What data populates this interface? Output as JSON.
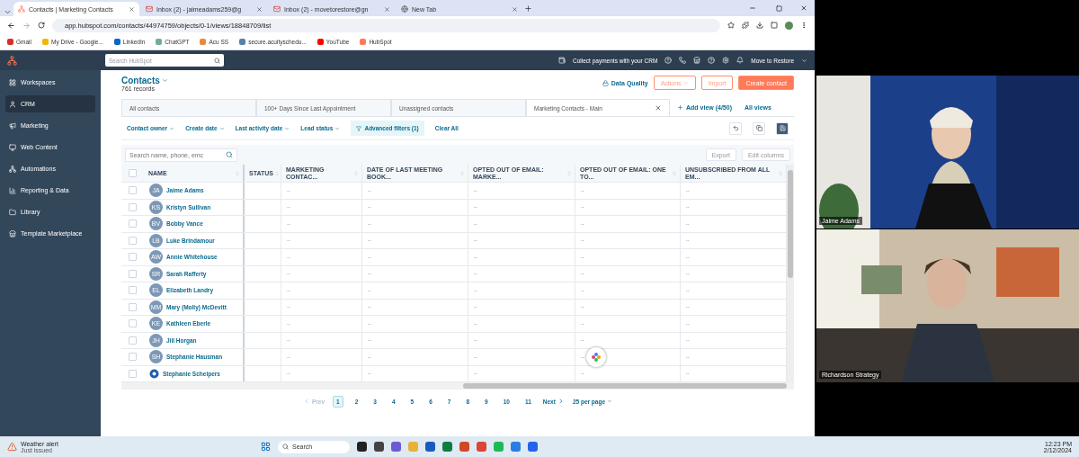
{
  "browser": {
    "tabs": [
      {
        "title": "Contacts | Marketing Contacts",
        "kind": "hubspot",
        "selected": true
      },
      {
        "title": "Inbox (2) - jaimeadams259@g",
        "kind": "mail",
        "selected": false
      },
      {
        "title": "Inbox (2) - movetorestore@gn",
        "kind": "mail",
        "selected": false
      },
      {
        "title": "New Tab",
        "kind": "globe",
        "selected": false
      }
    ],
    "url": "app.hubspot.com/contacts/44974759/objects/0-1/views/18848709/list",
    "bookmarks": [
      {
        "label": "Gmail",
        "color": "#d93025"
      },
      {
        "label": "My Drive - Google...",
        "color": "#f4b400"
      },
      {
        "label": "LinkedIn",
        "color": "#0a66c2"
      },
      {
        "label": "ChatGPT",
        "color": "#74aa9c"
      },
      {
        "label": "Acu SS",
        "color": "#e8893a"
      },
      {
        "label": "secure.acuityschedu...",
        "color": "#5b7fa8"
      },
      {
        "label": "YouTube",
        "color": "#ff0000"
      },
      {
        "label": "HubSpot",
        "color": "#ff7a59"
      }
    ]
  },
  "topnav": {
    "search_placeholder": "Search HubSpot",
    "promo": "Collect payments with your CRM",
    "account": "Move to Restore"
  },
  "sidebar": {
    "items": [
      {
        "label": "Workspaces",
        "selected": false
      },
      {
        "label": "CRM",
        "selected": true
      },
      {
        "label": "Marketing",
        "selected": false
      },
      {
        "label": "Web Content",
        "selected": false
      },
      {
        "label": "Automations",
        "selected": false
      },
      {
        "label": "Reporting & Data",
        "selected": false
      },
      {
        "label": "Library",
        "selected": false
      },
      {
        "label": "Template Marketplace",
        "selected": false
      }
    ]
  },
  "page": {
    "title": "Contacts",
    "records": "761 records",
    "data_quality": "Data Quality",
    "actions": "Actions",
    "import": "Import",
    "create": "Create contact",
    "views": [
      {
        "label": "All contacts",
        "selected": false
      },
      {
        "label": "100+ Days Since Last Appointment",
        "selected": false
      },
      {
        "label": "Unassigned contacts",
        "selected": false
      },
      {
        "label": "Marketing Contacts - Main",
        "selected": true
      }
    ],
    "add_view": "Add view (4/50)",
    "all_views": "All views",
    "filters": [
      "Contact owner",
      "Create date",
      "Last activity date",
      "Lead status"
    ],
    "advanced_filters": "Advanced filters (1)",
    "clear_all": "Clear All",
    "table_search_placeholder": "Search name, phone, emc",
    "export": "Export",
    "edit_columns": "Edit columns"
  },
  "table": {
    "all_checked": false,
    "columns": [
      {
        "label": "NAME",
        "kind": "name"
      },
      {
        "label": "STATUS",
        "kind": "data"
      },
      {
        "label": "MARKETING CONTAC...",
        "kind": "data"
      },
      {
        "label": "DATE OF LAST MEETING BOOK...",
        "kind": "data"
      },
      {
        "label": "OPTED OUT OF EMAIL: MARKE...",
        "kind": "data"
      },
      {
        "label": "OPTED OUT OF EMAIL: ONE TO...",
        "kind": "data"
      },
      {
        "label": "UNSUBSCRIBED FROM ALL EM...",
        "kind": "data"
      }
    ],
    "rows": [
      {
        "initials": "JA",
        "kind": "initials",
        "checked": false,
        "cells": [
          "Jaime Adams",
          "",
          "--",
          "--",
          "--",
          "--",
          "--"
        ]
      },
      {
        "initials": "KS",
        "kind": "initials",
        "checked": false,
        "cells": [
          "Kristyn Sullivan",
          "",
          "--",
          "--",
          "--",
          "--",
          "--"
        ]
      },
      {
        "initials": "BV",
        "kind": "initials",
        "checked": false,
        "cells": [
          "Bobby Vance",
          "",
          "--",
          "--",
          "--",
          "--",
          "--"
        ]
      },
      {
        "initials": "LB",
        "kind": "initials",
        "checked": false,
        "cells": [
          "Luke Brindamour",
          "",
          "--",
          "--",
          "--",
          "--",
          "--"
        ]
      },
      {
        "initials": "AW",
        "kind": "initials",
        "checked": false,
        "cells": [
          "Annie Whitehouse",
          "",
          "--",
          "--",
          "--",
          "--",
          "--"
        ]
      },
      {
        "initials": "SR",
        "kind": "initials",
        "checked": false,
        "cells": [
          "Sarah Rafferty",
          "",
          "--",
          "--",
          "--",
          "--",
          "--"
        ]
      },
      {
        "initials": "EL",
        "kind": "initials",
        "checked": false,
        "cells": [
          "Elizabeth Landry",
          "",
          "--",
          "--",
          "--",
          "--",
          "--"
        ]
      },
      {
        "initials": "MM",
        "kind": "initials",
        "checked": false,
        "cells": [
          "Mary (Molly) McDevitt",
          "",
          "--",
          "--",
          "--",
          "--",
          "--"
        ]
      },
      {
        "initials": "KE",
        "kind": "initials",
        "checked": false,
        "cells": [
          "Kathleen Eberle",
          "",
          "--",
          "--",
          "--",
          "--",
          "--"
        ]
      },
      {
        "initials": "JH",
        "kind": "initials",
        "checked": false,
        "cells": [
          "Jill Horgan",
          "",
          "--",
          "--",
          "--",
          "--",
          "--"
        ]
      },
      {
        "initials": "SH",
        "kind": "initials",
        "checked": false,
        "cells": [
          "Stephanie Hausman",
          "",
          "--",
          "--",
          "--",
          "--",
          "--"
        ]
      },
      {
        "kind": "logo",
        "checked": false,
        "cells": [
          "Stephanie Scheipers",
          "",
          "--",
          "--",
          "--",
          "--",
          "--"
        ]
      }
    ]
  },
  "pagination": {
    "prev": "Prev",
    "prev_disabled": true,
    "pages": [
      {
        "label": "1",
        "selected": true
      },
      {
        "label": "2",
        "selected": false
      },
      {
        "label": "3",
        "selected": false
      },
      {
        "label": "4",
        "selected": false
      },
      {
        "label": "5",
        "selected": false
      },
      {
        "label": "6",
        "selected": false
      },
      {
        "label": "7",
        "selected": false
      },
      {
        "label": "8",
        "selected": false
      },
      {
        "label": "9",
        "selected": false
      },
      {
        "label": "10",
        "selected": false
      },
      {
        "label": "11",
        "selected": false
      }
    ],
    "next": "Next",
    "per_page": "25 per page"
  },
  "video_tiles": [
    {
      "name": "Jaime Adams",
      "kind": "picture"
    },
    {
      "name": "Richardson Strategy",
      "kind": "picture"
    }
  ],
  "taskbar": {
    "alert_title": "Weather alert",
    "alert_subtitle": "Just issued",
    "search": "Search",
    "time": "12:23 PM",
    "date": "2/12/2024"
  }
}
